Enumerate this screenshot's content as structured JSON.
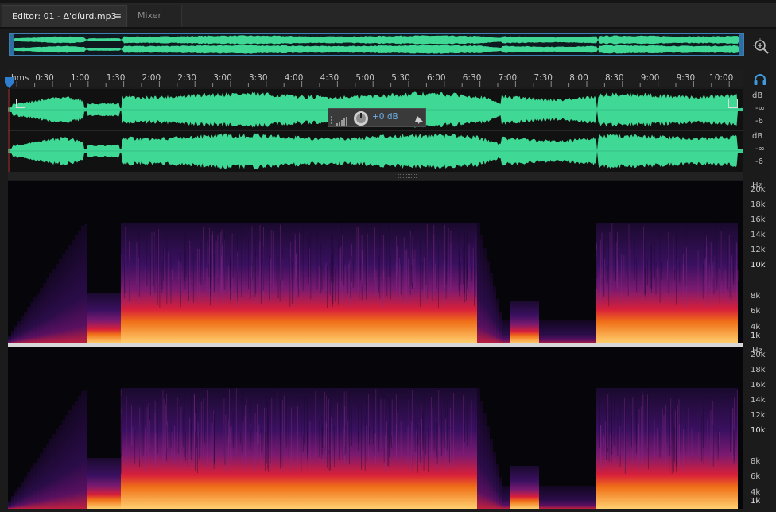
{
  "tabs": {
    "editor_label": "Editor: 01 - Δ'díurd.mp3",
    "editor_menu_glyph": "≡",
    "mixer_label": "Mixer"
  },
  "icons": {
    "zoom": "zoom-magnifier-icon",
    "headphones": "headphones-icon",
    "playhead": "playhead-marker-icon",
    "hud_meter": "level-meter-icon",
    "hud_knob": "volume-knob-icon",
    "hud_pin": "pin-icon"
  },
  "ruler": {
    "unit_label": "hms",
    "ticks": [
      "0:30",
      "1:00",
      "1:30",
      "2:00",
      "2:30",
      "3:00",
      "3:30",
      "4:00",
      "4:30",
      "5:00",
      "5:30",
      "6:00",
      "6:30",
      "7:00",
      "7:30",
      "8:00",
      "8:30",
      "9:00",
      "9:30",
      "10:00"
    ]
  },
  "hud": {
    "gain_label": "+0 dB"
  },
  "amplitude_scale": {
    "unit": "dB",
    "inf": "-∞",
    "minus6": "-6"
  },
  "frequency_scale": {
    "unit": "Hz",
    "labels": [
      "20k",
      "18k",
      "16k",
      "14k",
      "12k",
      "10k",
      "8k",
      "6k",
      "4k",
      "1k"
    ]
  },
  "colors": {
    "waveform": "#3fd894",
    "selection_border": "#3c7fb0",
    "accent_blue": "#3d9be0",
    "gain_text": "#6fb0e6"
  }
}
